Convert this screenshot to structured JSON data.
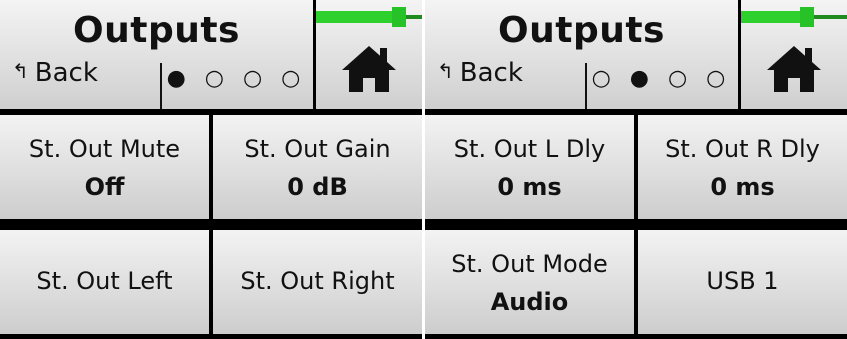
{
  "screens": [
    {
      "title": "Outputs",
      "back_label": "Back",
      "back_icon": "return-arrow",
      "page_dots": "● ○ ○ ○",
      "meter_level": 0.78,
      "home_icon": "home-icon",
      "cells": [
        {
          "label": "St. Out Mute",
          "value": "Off"
        },
        {
          "label": "St. Out Gain",
          "value": "0 dB"
        },
        {
          "label": "St. Out Left",
          "value": ""
        },
        {
          "label": "St. Out Right",
          "value": ""
        }
      ]
    },
    {
      "title": "Outputs",
      "back_label": "Back",
      "back_icon": "return-arrow",
      "page_dots": "○ ● ○ ○",
      "meter_level": 0.62,
      "home_icon": "home-icon",
      "cells": [
        {
          "label": "St. Out L Dly",
          "value": "0 ms"
        },
        {
          "label": "St. Out R Dly",
          "value": "0 ms"
        },
        {
          "label": "St. Out Mode",
          "value": "Audio"
        },
        {
          "label": "USB 1",
          "value": ""
        }
      ]
    }
  ],
  "colors": {
    "meter_fill": "#2ed02e",
    "meter_track": "#1f8b1f",
    "panel_bg": "#000000"
  }
}
